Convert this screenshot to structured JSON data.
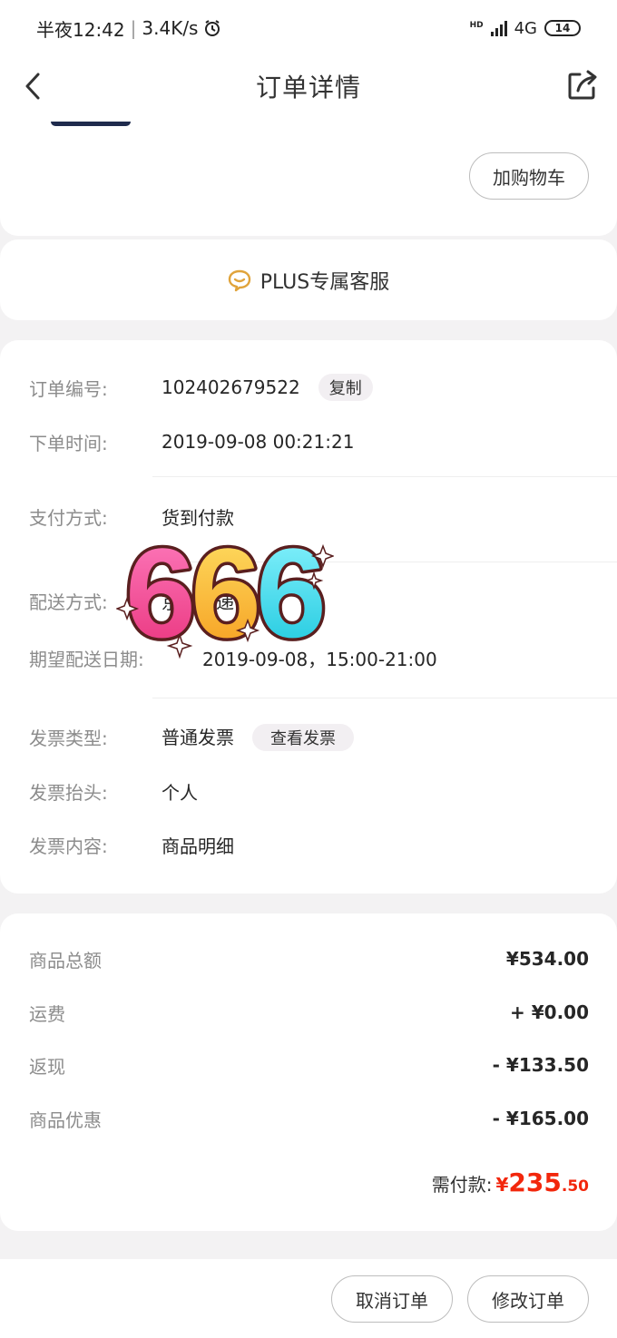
{
  "status_bar": {
    "time": "半夜12:42",
    "speed": "3.4K/s",
    "hd_label": "HD",
    "network": "4G",
    "battery": "14"
  },
  "nav": {
    "title": "订单详情"
  },
  "product": {
    "add_cart_label": "加购物车"
  },
  "service": {
    "label": "PLUS专属客服"
  },
  "order_info": {
    "order_no_label": "订单编号:",
    "order_no": "102402679522",
    "copy_label": "复制",
    "time_label": "下单时间:",
    "time": "2019-09-08 00:21:21",
    "pay_label": "支付方式:",
    "pay": "货到付款",
    "delivery_label": "配送方式:",
    "delivery": "京东快递",
    "expect_label": "期望配送日期:",
    "expect": "2019-09-08，15:00-21:00",
    "invoice_type_label": "发票类型:",
    "invoice_type": "普通发票",
    "view_invoice_label": "查看发票",
    "invoice_title_label": "发票抬头:",
    "invoice_title": "个人",
    "invoice_content_label": "发票内容:",
    "invoice_content": "商品明细"
  },
  "price": {
    "total_label": "商品总额",
    "total": "¥534.00",
    "shipping_label": "运费",
    "shipping": "+ ¥0.00",
    "cashback_label": "返现",
    "cashback": "- ¥133.50",
    "discount_label": "商品优惠",
    "discount": "- ¥165.00",
    "pay_label": "需付款:",
    "pay_symbol": "¥",
    "pay_int": "235",
    "pay_dec": ".50"
  },
  "actions": {
    "cancel_label": "取消订单",
    "modify_label": "修改订单"
  },
  "sticker": {
    "text": "666"
  },
  "colors": {
    "accent_red": "#f2270c",
    "service_gold": "#e0a33a"
  },
  "icons": {
    "back": "chevron-left-icon",
    "share": "share-icon",
    "service": "chat-bubble-icon",
    "alarm": "alarm-icon"
  }
}
